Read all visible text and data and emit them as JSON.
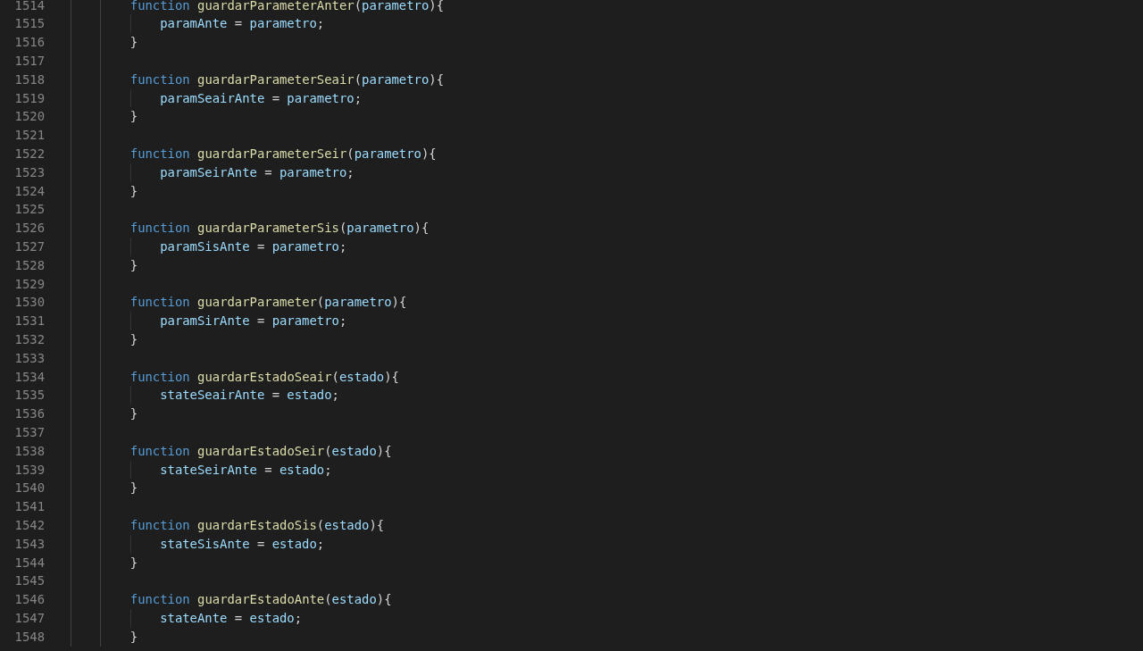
{
  "editor": {
    "lines": [
      {
        "number": "1514",
        "kind": "decl",
        "tokens": [
          {
            "kind": "keyword",
            "text": "function"
          },
          {
            "kind": "function",
            "text": " guardarParameterAnter"
          },
          {
            "kind": "punct",
            "text": "("
          },
          {
            "kind": "variable",
            "text": "parametro"
          },
          {
            "kind": "punct",
            "text": "){"
          }
        ]
      },
      {
        "number": "1515",
        "kind": "body",
        "tokens": [
          {
            "kind": "variable",
            "text": "paramAnte"
          },
          {
            "kind": "punct",
            "text": " = "
          },
          {
            "kind": "variable",
            "text": "parametro"
          },
          {
            "kind": "punct",
            "text": ";"
          }
        ]
      },
      {
        "number": "1516",
        "kind": "close",
        "tokens": [
          {
            "kind": "punct",
            "text": "}"
          }
        ]
      },
      {
        "number": "1517",
        "kind": "blank"
      },
      {
        "number": "1518",
        "kind": "decl",
        "tokens": [
          {
            "kind": "keyword",
            "text": "function"
          },
          {
            "kind": "function",
            "text": " guardarParameterSeair"
          },
          {
            "kind": "punct",
            "text": "("
          },
          {
            "kind": "variable",
            "text": "parametro"
          },
          {
            "kind": "punct",
            "text": "){"
          }
        ]
      },
      {
        "number": "1519",
        "kind": "body",
        "tokens": [
          {
            "kind": "variable",
            "text": "paramSeairAnte"
          },
          {
            "kind": "punct",
            "text": " = "
          },
          {
            "kind": "variable",
            "text": "parametro"
          },
          {
            "kind": "punct",
            "text": ";"
          }
        ]
      },
      {
        "number": "1520",
        "kind": "close",
        "tokens": [
          {
            "kind": "punct",
            "text": "}"
          }
        ]
      },
      {
        "number": "1521",
        "kind": "blank"
      },
      {
        "number": "1522",
        "kind": "decl",
        "tokens": [
          {
            "kind": "keyword",
            "text": "function"
          },
          {
            "kind": "function",
            "text": " guardarParameterSeir"
          },
          {
            "kind": "punct",
            "text": "("
          },
          {
            "kind": "variable",
            "text": "parametro"
          },
          {
            "kind": "punct",
            "text": "){"
          }
        ]
      },
      {
        "number": "1523",
        "kind": "body",
        "tokens": [
          {
            "kind": "variable",
            "text": "paramSeirAnte"
          },
          {
            "kind": "punct",
            "text": " = "
          },
          {
            "kind": "variable",
            "text": "parametro"
          },
          {
            "kind": "punct",
            "text": ";"
          }
        ]
      },
      {
        "number": "1524",
        "kind": "close",
        "tokens": [
          {
            "kind": "punct",
            "text": "}"
          }
        ]
      },
      {
        "number": "1525",
        "kind": "blank"
      },
      {
        "number": "1526",
        "kind": "decl",
        "tokens": [
          {
            "kind": "keyword",
            "text": "function"
          },
          {
            "kind": "function",
            "text": " guardarParameterSis"
          },
          {
            "kind": "punct",
            "text": "("
          },
          {
            "kind": "variable",
            "text": "parametro"
          },
          {
            "kind": "punct",
            "text": "){"
          }
        ]
      },
      {
        "number": "1527",
        "kind": "body",
        "tokens": [
          {
            "kind": "variable",
            "text": "paramSisAnte"
          },
          {
            "kind": "punct",
            "text": " = "
          },
          {
            "kind": "variable",
            "text": "parametro"
          },
          {
            "kind": "punct",
            "text": ";"
          }
        ]
      },
      {
        "number": "1528",
        "kind": "close",
        "tokens": [
          {
            "kind": "punct",
            "text": "}"
          }
        ]
      },
      {
        "number": "1529",
        "kind": "blank"
      },
      {
        "number": "1530",
        "kind": "decl",
        "tokens": [
          {
            "kind": "keyword",
            "text": "function"
          },
          {
            "kind": "function",
            "text": " guardarParameter"
          },
          {
            "kind": "punct",
            "text": "("
          },
          {
            "kind": "variable",
            "text": "parametro"
          },
          {
            "kind": "punct",
            "text": "){"
          }
        ]
      },
      {
        "number": "1531",
        "kind": "body",
        "tokens": [
          {
            "kind": "variable",
            "text": "paramSirAnte"
          },
          {
            "kind": "punct",
            "text": " = "
          },
          {
            "kind": "variable",
            "text": "parametro"
          },
          {
            "kind": "punct",
            "text": ";"
          }
        ]
      },
      {
        "number": "1532",
        "kind": "close",
        "tokens": [
          {
            "kind": "punct",
            "text": "}"
          }
        ]
      },
      {
        "number": "1533",
        "kind": "blank"
      },
      {
        "number": "1534",
        "kind": "decl",
        "tokens": [
          {
            "kind": "keyword",
            "text": "function"
          },
          {
            "kind": "function",
            "text": " guardarEstadoSeair"
          },
          {
            "kind": "punct",
            "text": "("
          },
          {
            "kind": "variable",
            "text": "estado"
          },
          {
            "kind": "punct",
            "text": "){"
          }
        ]
      },
      {
        "number": "1535",
        "kind": "body",
        "tokens": [
          {
            "kind": "variable",
            "text": "stateSeairAnte"
          },
          {
            "kind": "punct",
            "text": " = "
          },
          {
            "kind": "variable",
            "text": "estado"
          },
          {
            "kind": "punct",
            "text": ";"
          }
        ]
      },
      {
        "number": "1536",
        "kind": "close",
        "tokens": [
          {
            "kind": "punct",
            "text": "}"
          }
        ]
      },
      {
        "number": "1537",
        "kind": "blank"
      },
      {
        "number": "1538",
        "kind": "decl",
        "tokens": [
          {
            "kind": "keyword",
            "text": "function"
          },
          {
            "kind": "function",
            "text": " guardarEstadoSeir"
          },
          {
            "kind": "punct",
            "text": "("
          },
          {
            "kind": "variable",
            "text": "estado"
          },
          {
            "kind": "punct",
            "text": "){"
          }
        ]
      },
      {
        "number": "1539",
        "kind": "body",
        "tokens": [
          {
            "kind": "variable",
            "text": "stateSeirAnte"
          },
          {
            "kind": "punct",
            "text": " = "
          },
          {
            "kind": "variable",
            "text": "estado"
          },
          {
            "kind": "punct",
            "text": ";"
          }
        ]
      },
      {
        "number": "1540",
        "kind": "close",
        "tokens": [
          {
            "kind": "punct",
            "text": "}"
          }
        ]
      },
      {
        "number": "1541",
        "kind": "blank"
      },
      {
        "number": "1542",
        "kind": "decl",
        "tokens": [
          {
            "kind": "keyword",
            "text": "function"
          },
          {
            "kind": "function",
            "text": " guardarEstadoSis"
          },
          {
            "kind": "punct",
            "text": "("
          },
          {
            "kind": "variable",
            "text": "estado"
          },
          {
            "kind": "punct",
            "text": "){"
          }
        ]
      },
      {
        "number": "1543",
        "kind": "body",
        "tokens": [
          {
            "kind": "variable",
            "text": "stateSisAnte"
          },
          {
            "kind": "punct",
            "text": " = "
          },
          {
            "kind": "variable",
            "text": "estado"
          },
          {
            "kind": "punct",
            "text": ";"
          }
        ]
      },
      {
        "number": "1544",
        "kind": "close",
        "tokens": [
          {
            "kind": "punct",
            "text": "}"
          }
        ]
      },
      {
        "number": "1545",
        "kind": "blank"
      },
      {
        "number": "1546",
        "kind": "decl",
        "tokens": [
          {
            "kind": "keyword",
            "text": "function"
          },
          {
            "kind": "function",
            "text": " guardarEstadoAnte"
          },
          {
            "kind": "punct",
            "text": "("
          },
          {
            "kind": "variable",
            "text": "estado"
          },
          {
            "kind": "punct",
            "text": "){"
          }
        ]
      },
      {
        "number": "1547",
        "kind": "body",
        "tokens": [
          {
            "kind": "variable",
            "text": "stateAnte"
          },
          {
            "kind": "punct",
            "text": " = "
          },
          {
            "kind": "variable",
            "text": "estado"
          },
          {
            "kind": "punct",
            "text": ";"
          }
        ]
      },
      {
        "number": "1548",
        "kind": "close",
        "tokens": [
          {
            "kind": "punct",
            "text": "}"
          }
        ]
      }
    ]
  }
}
